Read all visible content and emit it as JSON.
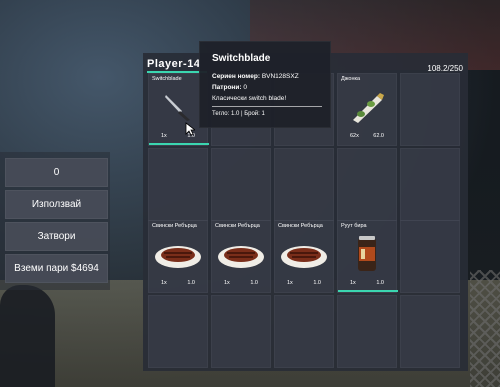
{
  "inventory": {
    "player_name": "Player-14",
    "weight": "108.2/250",
    "slots": [
      {
        "name": "Switchblade",
        "count": "1x",
        "weight": "1.0"
      },
      {
        "name": "Джонка",
        "count": "62x",
        "weight": "62.0"
      },
      {
        "name": "Свински Ребърца",
        "count": "1x",
        "weight": "1.0"
      },
      {
        "name": "Свински Ребърца",
        "count": "1x",
        "weight": "1.0"
      },
      {
        "name": "Свински Ребърца",
        "count": "1x",
        "weight": "1.0"
      },
      {
        "name": "Руут бира",
        "count": "1x",
        "weight": "1.0"
      }
    ]
  },
  "tooltip": {
    "title": "Switchblade",
    "serial_label": "Сериен номер:",
    "serial_value": "BVN128SXZ",
    "ammo_label": "Патрони:",
    "ammo_value": "0",
    "description": "Класически switch blade!",
    "footer": "Тегло: 1.0 | Брой: 1"
  },
  "actions": {
    "amount_value": "0",
    "use_label": "Използвай",
    "close_label": "Затвори",
    "take_money_label": "Вземи пари $4694"
  },
  "colors": {
    "accent": "#3bd6b0",
    "panel": "#282c36",
    "slot": "#3a3e4a"
  }
}
